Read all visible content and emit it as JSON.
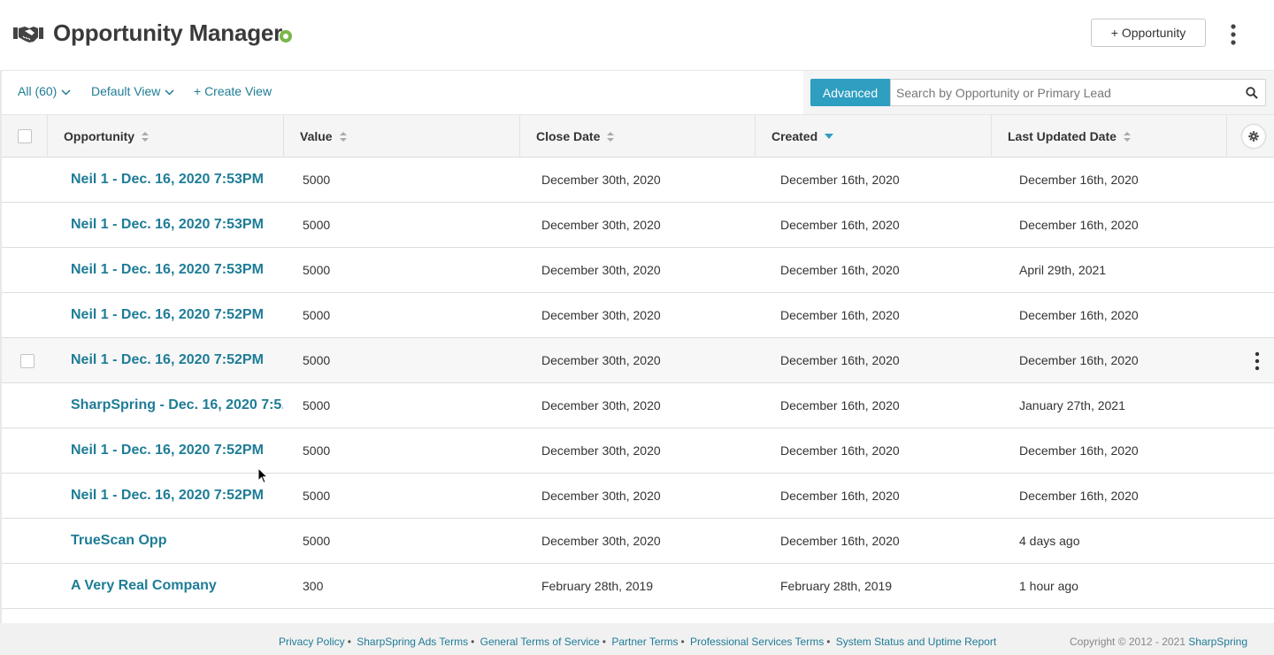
{
  "header": {
    "title": "Opportunity Manager",
    "add_button_label": "+ Opportunity",
    "logo_icon": "handshake-icon",
    "status_icon": "green-badge-icon",
    "menu_icon": "kebab-vertical-icon"
  },
  "toolbar": {
    "filter_label": "All (60)",
    "view_label": "Default View",
    "create_view_label": "+ Create View",
    "advanced_label": "Advanced",
    "search_placeholder": "Search by Opportunity or Primary Lead"
  },
  "table": {
    "columns": [
      {
        "label": "Opportunity",
        "sort": "none"
      },
      {
        "label": "Value",
        "sort": "none"
      },
      {
        "label": "Close Date",
        "sort": "none"
      },
      {
        "label": "Created",
        "sort": "desc"
      },
      {
        "label": "Last Updated Date",
        "sort": "none"
      }
    ],
    "rows": [
      {
        "opportunity": "Neil 1 - Dec. 16, 2020 7:53PM",
        "value": "5000",
        "close_date": "December 30th, 2020",
        "created": "December 16th, 2020",
        "updated": "December 16th, 2020"
      },
      {
        "opportunity": "Neil 1 - Dec. 16, 2020 7:53PM",
        "value": "5000",
        "close_date": "December 30th, 2020",
        "created": "December 16th, 2020",
        "updated": "December 16th, 2020"
      },
      {
        "opportunity": "Neil 1 - Dec. 16, 2020 7:53PM",
        "value": "5000",
        "close_date": "December 30th, 2020",
        "created": "December 16th, 2020",
        "updated": "April 29th, 2021"
      },
      {
        "opportunity": "Neil 1 - Dec. 16, 2020 7:52PM",
        "value": "5000",
        "close_date": "December 30th, 2020",
        "created": "December 16th, 2020",
        "updated": "December 16th, 2020"
      },
      {
        "opportunity": "Neil 1 - Dec. 16, 2020 7:52PM",
        "value": "5000",
        "close_date": "December 30th, 2020",
        "created": "December 16th, 2020",
        "updated": "December 16th, 2020"
      },
      {
        "opportunity": "SharpSpring - Dec. 16, 2020 7:5...",
        "value": "5000",
        "close_date": "December 30th, 2020",
        "created": "December 16th, 2020",
        "updated": "January 27th, 2021"
      },
      {
        "opportunity": "Neil 1 - Dec. 16, 2020 7:52PM",
        "value": "5000",
        "close_date": "December 30th, 2020",
        "created": "December 16th, 2020",
        "updated": "December 16th, 2020"
      },
      {
        "opportunity": "Neil 1 - Dec. 16, 2020 7:52PM",
        "value": "5000",
        "close_date": "December 30th, 2020",
        "created": "December 16th, 2020",
        "updated": "December 16th, 2020"
      },
      {
        "opportunity": "TrueScan Opp",
        "value": "5000",
        "close_date": "December 30th, 2020",
        "created": "December 16th, 2020",
        "updated": "4 days ago"
      },
      {
        "opportunity": "A Very Real Company",
        "value": "300",
        "close_date": "February 28th, 2019",
        "created": "February 28th, 2019",
        "updated": "1 hour ago"
      }
    ],
    "hovered_row": 4
  },
  "footer": {
    "links": [
      "Privacy Policy",
      "SharpSpring Ads Terms",
      "General Terms of Service",
      "Partner Terms",
      "Professional Services Terms",
      "System Status and Uptime Report"
    ],
    "copyright": "Copyright © 2012 - 2021",
    "brand": "SharpSpring"
  },
  "colors": {
    "link": "#1e7c96",
    "advanced_bg": "#2e9ec1",
    "status_green": "#7ab648"
  }
}
